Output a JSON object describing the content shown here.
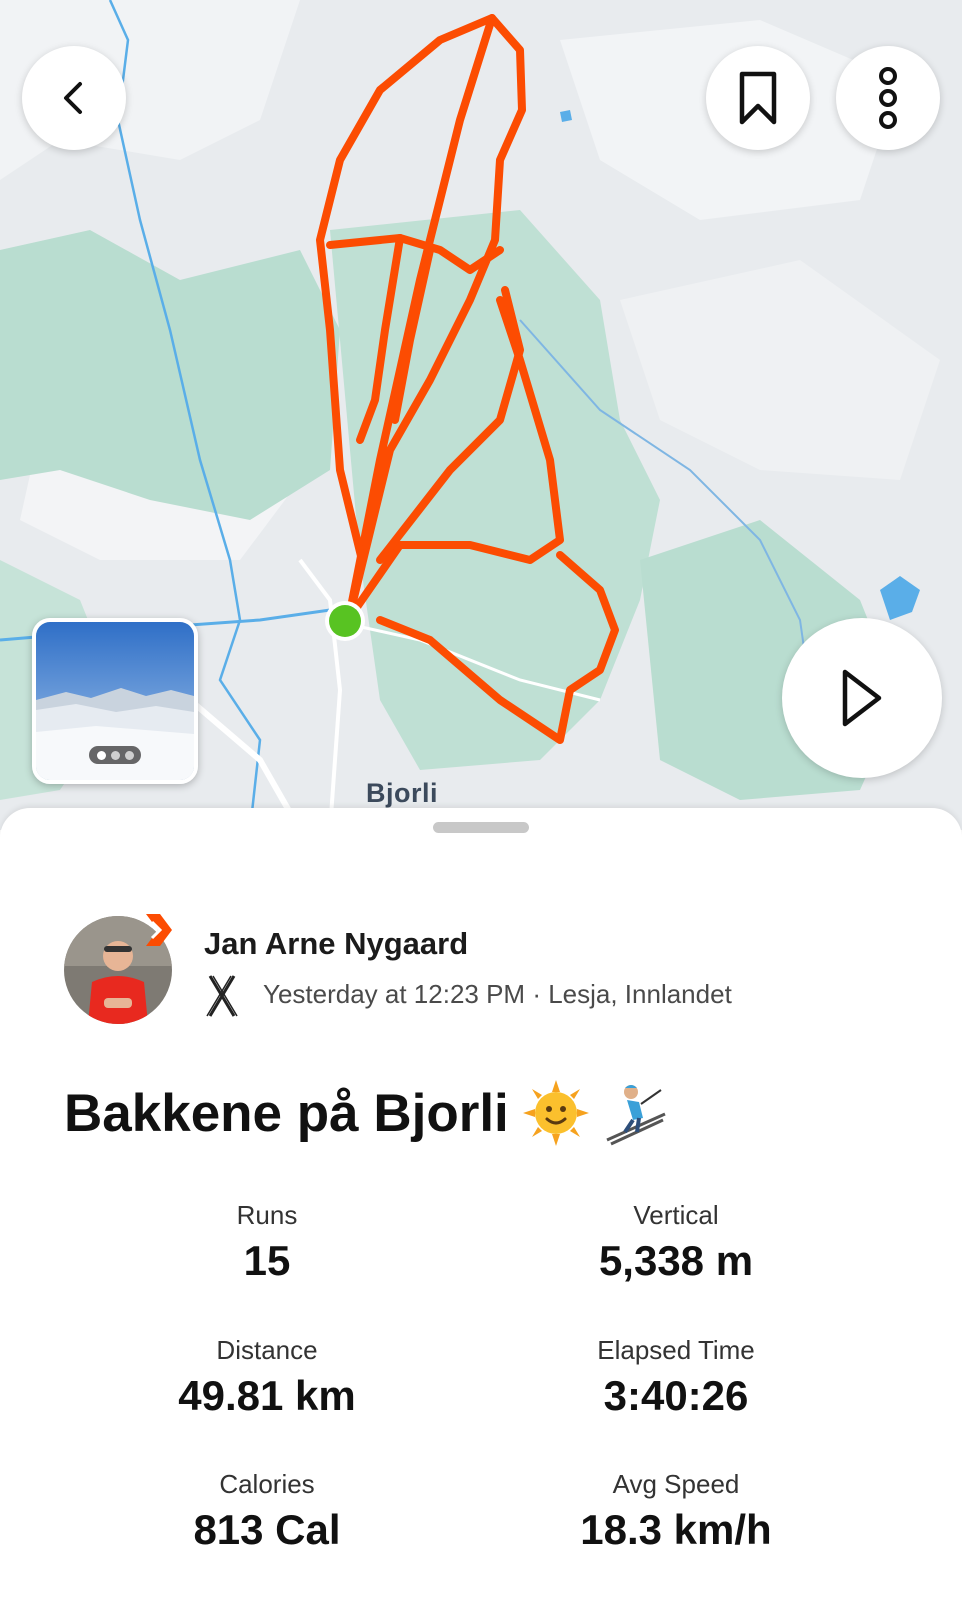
{
  "map": {
    "place_label": "Bjorli",
    "colors": {
      "route": "#fc4c02",
      "start_dot": "#58c322",
      "forest": "#b9ddd0",
      "water": "#5aaee8"
    }
  },
  "toolbar": {
    "back_icon": "chevron-left-icon",
    "bookmark_icon": "bookmark-icon",
    "more_icon": "more-vertical-icon",
    "play_icon": "play-icon"
  },
  "photo": {
    "description_icon": "photo-carousel-indicator"
  },
  "athlete": {
    "name": "Jan Arne Nygaard",
    "meta": "Yesterday at 12:23 PM · Lesja, Innlandet",
    "sport_icon": "alpine-ski-icon"
  },
  "activity": {
    "title": "Bakkene på Bjorli",
    "title_emoji": [
      "sun-with-face-icon",
      "skier-icon"
    ]
  },
  "stats": [
    {
      "label": "Runs",
      "value": "15"
    },
    {
      "label": "Vertical",
      "value": "5,338 m"
    },
    {
      "label": "Distance",
      "value": "49.81 km"
    },
    {
      "label": "Elapsed Time",
      "value": "3:40:26"
    },
    {
      "label": "Calories",
      "value": "813 Cal"
    },
    {
      "label": "Avg Speed",
      "value": "18.3 km/h"
    }
  ]
}
